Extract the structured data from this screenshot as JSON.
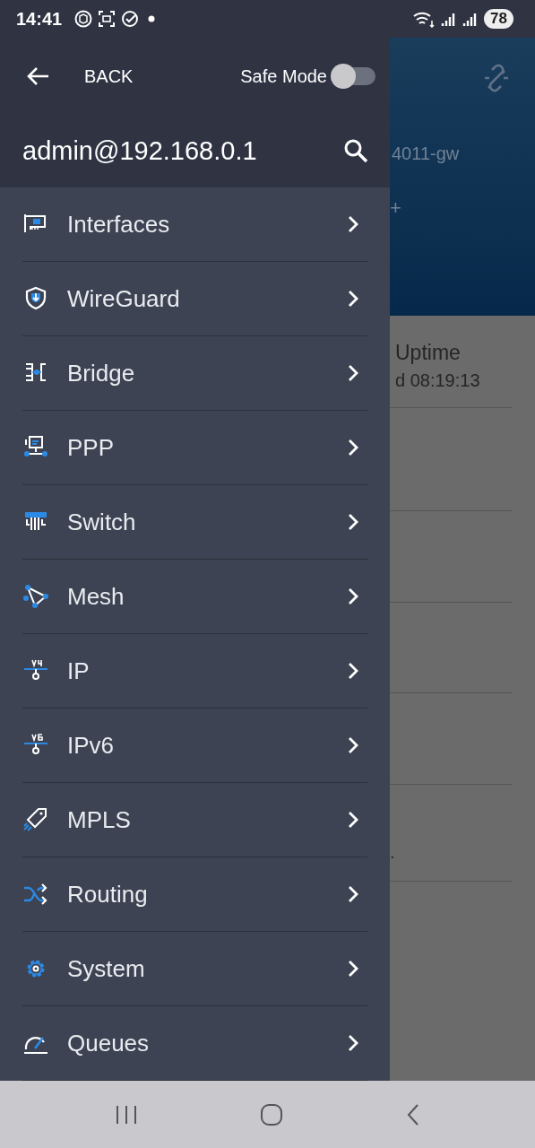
{
  "status_bar": {
    "time": "14:41",
    "battery": "78"
  },
  "drawer": {
    "back_label": "BACK",
    "safe_mode": {
      "label": "Safe Mode",
      "on": false
    },
    "connection": "admin@192.168.0.1",
    "items": [
      {
        "label": "Interfaces"
      },
      {
        "label": "WireGuard"
      },
      {
        "label": "Bridge"
      },
      {
        "label": "PPP"
      },
      {
        "label": "Switch"
      },
      {
        "label": "Mesh"
      },
      {
        "label": "IP"
      },
      {
        "label": "IPv6"
      },
      {
        "label": "MPLS"
      },
      {
        "label": "Routing"
      },
      {
        "label": "System"
      },
      {
        "label": "Queues"
      }
    ]
  },
  "background": {
    "device_name": "4011-gw",
    "header_mark": "+",
    "uptime_label": "Uptime",
    "uptime_value": "d 08:19:13",
    "row_text": "."
  }
}
